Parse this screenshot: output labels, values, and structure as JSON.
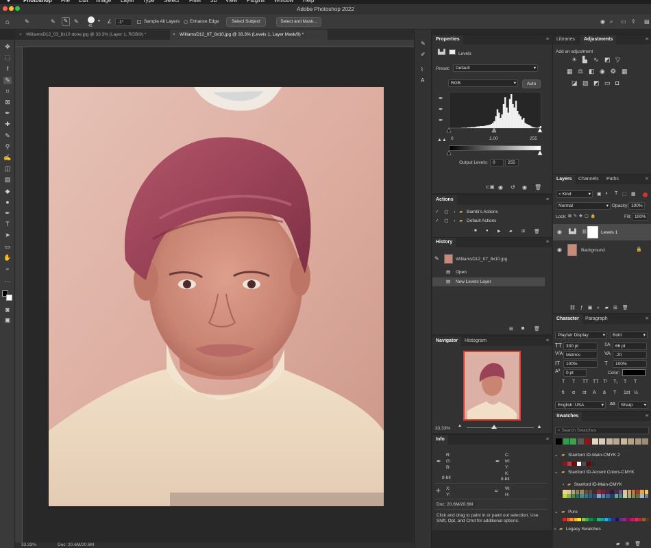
{
  "menubar": {
    "apple": "",
    "items": [
      "Photoshop",
      "File",
      "Edit",
      "Image",
      "Layer",
      "Type",
      "Select",
      "Filter",
      "3D",
      "View",
      "Plugins",
      "Window",
      "Help"
    ]
  },
  "app": {
    "title": "Adobe Photoshop 2022"
  },
  "options": {
    "brush_size": "45",
    "angle": "-1°",
    "sample_all_layers": "Sample All Layers",
    "enhance_edge": "Enhance Edge",
    "select_subject": "Select Subject",
    "select_and_mask": "Select and Mask..."
  },
  "tabs": [
    {
      "label": "WilliamsD12_03_8x10 done.jpg @ 33.3% (Layer 1, RGB/8) *"
    },
    {
      "label": "WilliamsD12_07_8x10.jpg @ 33.3% (Levels 1, Layer Mask/8) *"
    }
  ],
  "status": {
    "zoom": "33.33%",
    "doc": "Doc: 20.6M/20.6M"
  },
  "properties": {
    "tab": "Properties",
    "adjustment": "Levels",
    "preset_label": "Preset:",
    "preset": "Default",
    "channel": "RGB",
    "auto": "Auto",
    "input_low": "0",
    "input_mid": "1.00",
    "input_high": "255",
    "output_label": "Output Levels:",
    "output_low": "0",
    "output_high": "255",
    "histogram": [
      0,
      0,
      0,
      0,
      0,
      0,
      0,
      0,
      1,
      1,
      1,
      1,
      2,
      2,
      3,
      3,
      3,
      4,
      5,
      5,
      6,
      6,
      6,
      7,
      8,
      9,
      10,
      12,
      15,
      20,
      35,
      55,
      45,
      30,
      40,
      70,
      90,
      60,
      45,
      85,
      100,
      70,
      60,
      80,
      50,
      40,
      35,
      25,
      30,
      15,
      12,
      10,
      8,
      5,
      3,
      2,
      1,
      1,
      2,
      6
    ]
  },
  "actions": {
    "tab": "Actions",
    "items": [
      "Bambi's Actions",
      "Default Actions"
    ]
  },
  "history": {
    "tab": "History",
    "snapshot": "WilliamsD12_07_8x10.jpg",
    "items": [
      "Open",
      "New Levels Layer"
    ]
  },
  "navigator": {
    "tabs": [
      "Navigator",
      "Histogram"
    ],
    "zoom": "33.33%"
  },
  "info": {
    "tab": "Info",
    "rgb_labels": [
      "R:",
      "G:",
      "B:"
    ],
    "cmyk_labels": [
      "C:",
      "M:",
      "Y:",
      "K:"
    ],
    "bit_left": "8-bit",
    "bit_right": "8-bit",
    "xy_labels": [
      "X:",
      "Y:"
    ],
    "wh_labels": [
      "W:",
      "H:"
    ],
    "doc": "Doc: 20.6M/20.6M",
    "hint": "Click and drag to paint in or paint out selection.  Use Shift, Opt, and Cmd for additional options."
  },
  "libraries": {
    "tabs": [
      "Libraries",
      "Adjustments"
    ],
    "add_label": "Add an adjustment"
  },
  "layers": {
    "tabs": [
      "Layers",
      "Channels",
      "Paths"
    ],
    "filter": "Kind",
    "blend": "Normal",
    "opacity_label": "Opacity:",
    "opacity": "100%",
    "lock_label": "Lock:",
    "fill_label": "Fill:",
    "fill": "100%",
    "items": [
      {
        "name": "Levels 1"
      },
      {
        "name": "Background"
      }
    ]
  },
  "character": {
    "tabs": [
      "Character",
      "Paragraph"
    ],
    "font": "Playfair Display",
    "style": "Bold",
    "size": "330 pt",
    "leading": "66 pt",
    "kerning": "Metrics",
    "tracking": "-20",
    "vscale": "100%",
    "hscale": "100%",
    "baseline": "0 pt",
    "color_label": "Color:",
    "language": "English: USA",
    "aa": "Sharp",
    "style_buttons": [
      "T",
      "T",
      "TT",
      "TT",
      "T¹",
      "T₁",
      "T",
      "T"
    ],
    "ot_buttons": [
      "fi",
      "α",
      "st",
      "A",
      "ā",
      "T",
      "1st",
      "½"
    ]
  },
  "swatches": {
    "tab": "Swatches",
    "search": "Search Swatches",
    "recent": [
      "#000000",
      "#2e9e4a",
      "#3fa34d",
      "#5a5a5a",
      "#8c1515",
      "#e3d7c4",
      "#d9c9b5",
      "#c5b59f",
      "#b8a88f",
      "#c8b99a",
      "#b3a288",
      "#a8987f",
      "#9d8d74"
    ],
    "groups": [
      "Stanford ID-Main-CMYK 2",
      "Stanford ID-Accent Colors-CMYK",
      "Stanford ID-Main-CMYK",
      "Pure",
      "Legacy Swatches"
    ],
    "main2_colors": [
      "#8c1515",
      "#b83a4b",
      "#820000",
      "#ffffff",
      "#4d4f53",
      "#6f0000",
      "#2e2d29"
    ],
    "accent_colors": [
      "#e9d98b",
      "#e0c78b",
      "#b4a07c",
      "#8f7d5f",
      "#a7835e",
      "#6b4e32",
      "#5d4b3c",
      "#3b2f2a",
      "#9b2338",
      "#7a1f3a",
      "#54213b",
      "#2a1d3a",
      "#4c2a5a",
      "#6c4f86",
      "#e5bfa2",
      "#d9a06a",
      "#c66f3d",
      "#a3382b",
      "#e3a54d",
      "#f5c845",
      "#c4d646",
      "#86b04a",
      "#4f8a47",
      "#2f6e4f",
      "#3e8e8e",
      "#2b7a87",
      "#2f5f8f",
      "#2a4b7a",
      "#7aa9c6",
      "#4f88b5",
      "#37669b",
      "#1f3f6a",
      "#6aa6a0",
      "#3f8a82",
      "#c7d1a7",
      "#9db173",
      "#7b8f4f",
      "#5f7140",
      "#a6b5c7",
      "#6f7f95"
    ],
    "pure_colors": [
      "#ed1c24",
      "#f15a24",
      "#f7941d",
      "#fbb03b",
      "#fcee21",
      "#8cc63f",
      "#39b54a",
      "#009245",
      "#006837",
      "#22b573",
      "#00a99d",
      "#29abe2",
      "#0071bc",
      "#2e3192",
      "#1b1464",
      "#662d91",
      "#93278f",
      "#9e005d",
      "#d4145a",
      "#ed1e79",
      "#c1272d",
      "#8c6239",
      "#603813"
    ]
  },
  "colors": {
    "accent": "#1473e6",
    "nav_frame": "#e03c31"
  }
}
